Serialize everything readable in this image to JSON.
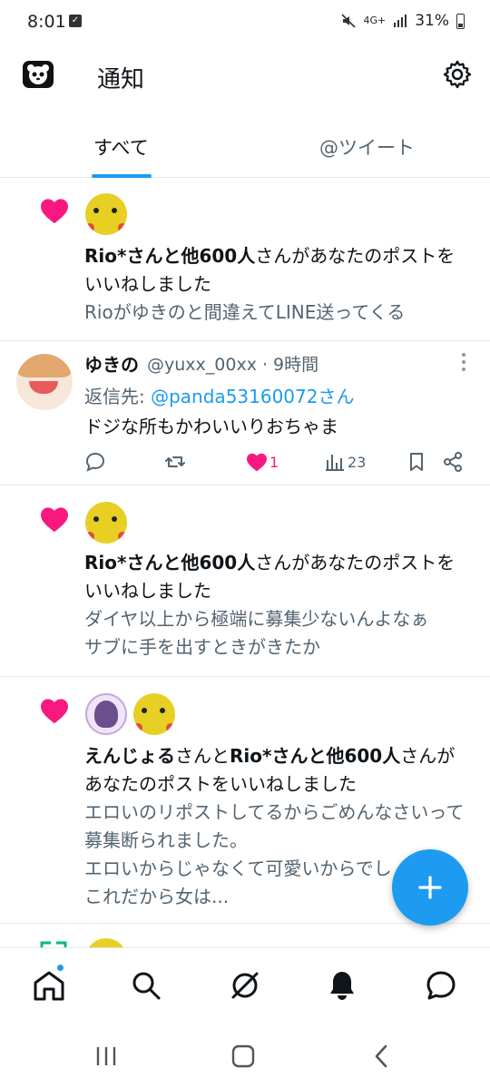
{
  "status_bar": {
    "time": "8:01",
    "network": "4G+",
    "battery": "31%"
  },
  "header": {
    "title": "通知",
    "logo_icon": "panda-app-logo-icon",
    "settings_icon": "gear-icon"
  },
  "tabs": [
    {
      "label": "すべて",
      "active": true
    },
    {
      "label": "@ツイート",
      "active": false
    }
  ],
  "notifications": [
    {
      "type": "like",
      "actors_bold": "Rio*さんと他600人",
      "action": "さんがあなたのポストをいいねしました",
      "preview": "Rioがゆきのと間違えてLINE送ってくる"
    },
    {
      "type": "like",
      "actors_bold": "Rio*さんと他600人",
      "action": "さんがあなたのポストをいいねしました",
      "preview": "ダイヤ以上から極端に募集少ないんよなぁ\nサブに手を出すときがきたか"
    },
    {
      "type": "like",
      "actor1_bold": "えんじょる",
      "mid": "さんと",
      "actors_bold": "Rio*さんと他600人",
      "action": "さんがあなたのポストをいいねしました",
      "preview": "エロいのリポストしてるからごめんなさいって募集断られました。\nエロいからじゃなくて可愛いからでしょ\nこれだから女は..."
    }
  ],
  "tweet": {
    "name": "ゆきの",
    "handle": "@yuxx_00xx · 9時間",
    "reply_prefix": "返信先: ",
    "reply_mention": "@panda53160072さん",
    "body": "ドジな所もかわいいりおちゃま",
    "likes": "1",
    "views": "23"
  },
  "colors": {
    "accent": "#1d9bf0",
    "like": "#f91880",
    "muted": "#536471"
  }
}
